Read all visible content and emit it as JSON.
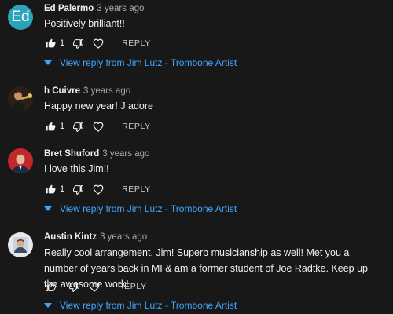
{
  "comments": [
    {
      "author": "Ed Palermo",
      "time": "3 years ago",
      "avatar_letter": "Ed",
      "text": "Positively brilliant!!",
      "likes": "1",
      "reply_label": "REPLY",
      "view_replies": "View reply from Jim Lutz - Trombone Artist"
    },
    {
      "author": "h Cuivre",
      "time": "3 years ago",
      "text": "Happy new year! J adore",
      "likes": "1",
      "reply_label": "REPLY"
    },
    {
      "author": "Bret Shuford",
      "time": "3 years ago",
      "text": "I love this Jim!!",
      "likes": "1",
      "reply_label": "REPLY",
      "view_replies": "View reply from Jim Lutz - Trombone Artist"
    },
    {
      "author": "Austin Kintz",
      "time": "3 years ago",
      "text": "Really cool arrangement, Jim! Superb musicianship as well! Met you a number of years back in MI & am a former student of Joe Radtke. Keep up the awesome work!",
      "reply_label": "REPLY",
      "view_replies": "View reply from Jim Lutz - Trombone Artist"
    }
  ],
  "colors": {
    "background": "#181818",
    "link": "#3ea6ff",
    "avatar_ed": "#2aa4b8"
  },
  "icons": {
    "like": "thumb-up-icon",
    "dislike": "thumb-down-icon",
    "heart": "heart-icon",
    "expand": "caret-down-icon"
  }
}
